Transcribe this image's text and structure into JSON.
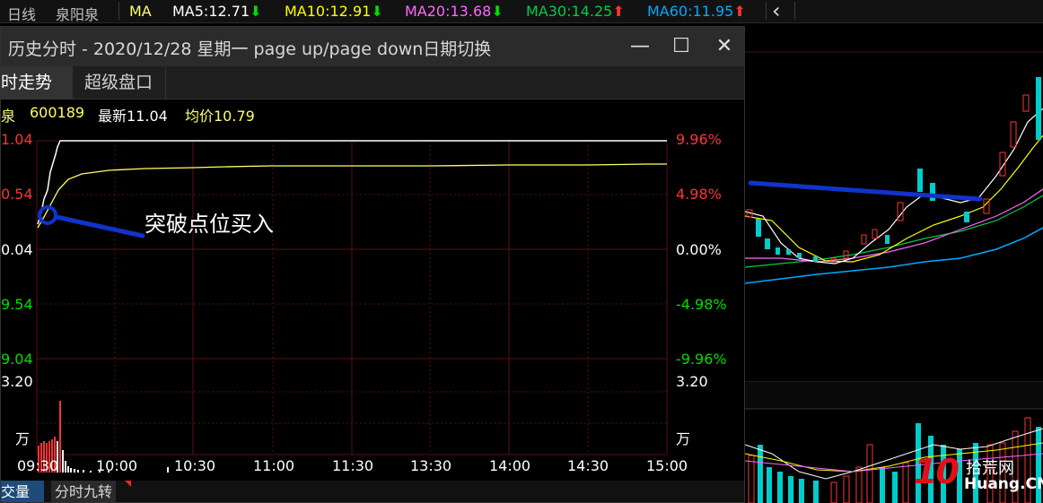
{
  "top_bar": {
    "period": "日线",
    "stock_name": "泉阳泉",
    "indicator": "MA",
    "ma5": "MA5:12.71",
    "ma10": "MA10:12.91",
    "ma20": "MA20:13.68",
    "ma30": "MA30:14.25",
    "ma60": "MA60:11.95",
    "collapse_glyph": "‹",
    "colors": {
      "ma5": "#ffffff",
      "ma10": "#ffff00",
      "ma20": "#ff66ff",
      "ma30": "#00cc44",
      "ma60": "#00aaff",
      "down": "#00dd00",
      "up": "#ff3333"
    }
  },
  "popup": {
    "title": "历史分时 - 2020/12/28 星期一 page up/page down日期切换",
    "buttons": {
      "minimize": "—",
      "maximize": "☐",
      "close": "✕"
    },
    "tabs": [
      "时走势",
      "超级盘口"
    ],
    "info": {
      "name": "泉",
      "code": "600189",
      "latest": "最新11.04",
      "avg": "均价10.79"
    },
    "price_labels_left": [
      "1.04",
      "0.54",
      "0.04",
      "9.54",
      "9.04"
    ],
    "pct_labels_right": [
      "9.96%",
      "4.98%",
      "0.00%",
      "-4.98%",
      "-9.96%"
    ],
    "volume_labels": {
      "left_top": "3.20",
      "left_unit": "万",
      "right_top": "3.20",
      "right_unit": "万"
    },
    "time_labels": [
      "09:30",
      "10:00",
      "10:30",
      "11:00",
      "11:30",
      "13:30",
      "14:00",
      "14:30",
      "15:00"
    ],
    "annotation": "突破点位买入",
    "bottom_tabs": [
      "交量",
      "分时九转"
    ]
  },
  "watermark": {
    "number": "10",
    "site_cn": "拾荒网",
    "site_en": "Huang.CN"
  }
}
